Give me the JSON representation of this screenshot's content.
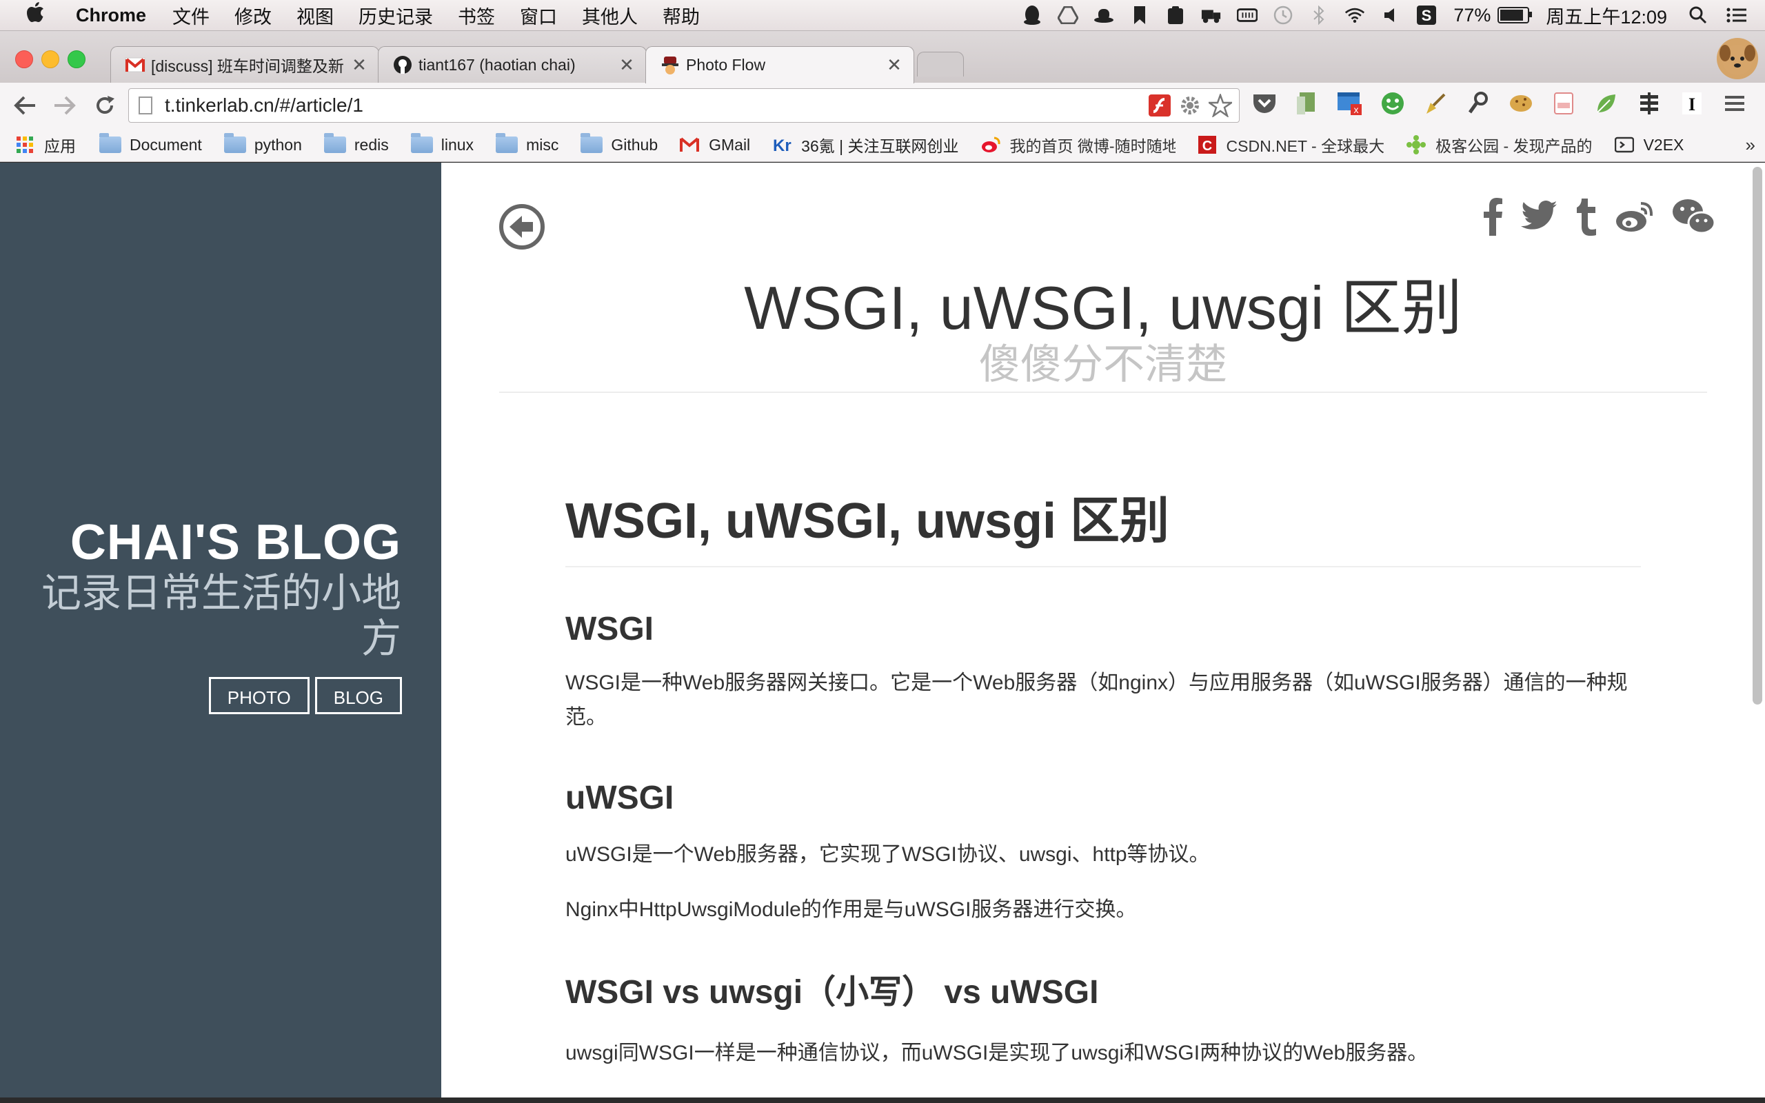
{
  "menubar": {
    "app_name": "Chrome",
    "menus": [
      "文件",
      "修改",
      "视图",
      "历史记录",
      "书签",
      "窗口",
      "其他人",
      "帮助"
    ],
    "battery_percent": "77%",
    "battery_level": 0.77,
    "clock": "周五上午12:09"
  },
  "tabs": [
    {
      "title": "[discuss] 班车时间调整及新",
      "favicon": "gmail-icon"
    },
    {
      "title": "tiant167 (haotian chai)",
      "favicon": "github-icon"
    },
    {
      "title": "Photo Flow",
      "favicon": "photo-flow-icon",
      "active": true
    }
  ],
  "address_bar": {
    "url": "t.tinkerlab.cn/#/article/1"
  },
  "bookmarks": [
    {
      "label": "应用",
      "icon": "apps-grid-icon"
    },
    {
      "label": "Document",
      "icon": "folder-icon"
    },
    {
      "label": "python",
      "icon": "folder-icon"
    },
    {
      "label": "redis",
      "icon": "folder-icon"
    },
    {
      "label": "linux",
      "icon": "folder-icon"
    },
    {
      "label": "misc",
      "icon": "folder-icon"
    },
    {
      "label": "Github",
      "icon": "folder-icon"
    },
    {
      "label": "GMail",
      "icon": "gmail-icon"
    },
    {
      "label": "36氪 | 关注互联网创业",
      "icon": "kr-icon"
    },
    {
      "label": "我的首页 微博-随时随地",
      "icon": "weibo-icon"
    },
    {
      "label": "CSDN.NET - 全球最大",
      "icon": "csdn-icon"
    },
    {
      "label": "极客公园 - 发现产品的",
      "icon": "geekpark-icon"
    },
    {
      "label": "V2EX",
      "icon": "v2ex-icon"
    }
  ],
  "sidebar": {
    "title": "CHAI'S BLOG",
    "subtitle": "记录日常生活的小地方",
    "buttons": [
      "PHOTO",
      "BLOG"
    ]
  },
  "article": {
    "page_title": "WSGI, uWSGI, uwsgi 区别",
    "page_subtitle": "傻傻分不清楚",
    "share_icons": [
      "facebook-icon",
      "twitter-icon",
      "tumblr-icon",
      "weibo-icon",
      "wechat-icon"
    ],
    "h1": "WSGI, uWSGI, uwsgi 区别",
    "sections": [
      {
        "heading": "WSGI",
        "paragraphs": [
          "WSGI是一种Web服务器网关接口。它是一个Web服务器（如nginx）与应用服务器（如uWSGI服务器）通信的一种规范。"
        ]
      },
      {
        "heading": "uWSGI",
        "paragraphs": [
          "uWSGI是一个Web服务器，它实现了WSGI协议、uwsgi、http等协议。",
          "Nginx中HttpUwsgiModule的作用是与uWSGI服务器进行交换。"
        ]
      },
      {
        "heading": "WSGI vs uwsgi（小写） vs uWSGI",
        "paragraphs": [
          "uwsgi同WSGI一样是一种通信协议，而uWSGI是实现了uwsgi和WSGI两种协议的Web服务器。"
        ]
      }
    ]
  },
  "colors": {
    "sidebar_bg": "#3f4f5b",
    "text": "#333333",
    "subtitle_gray": "#c5c5c5"
  }
}
